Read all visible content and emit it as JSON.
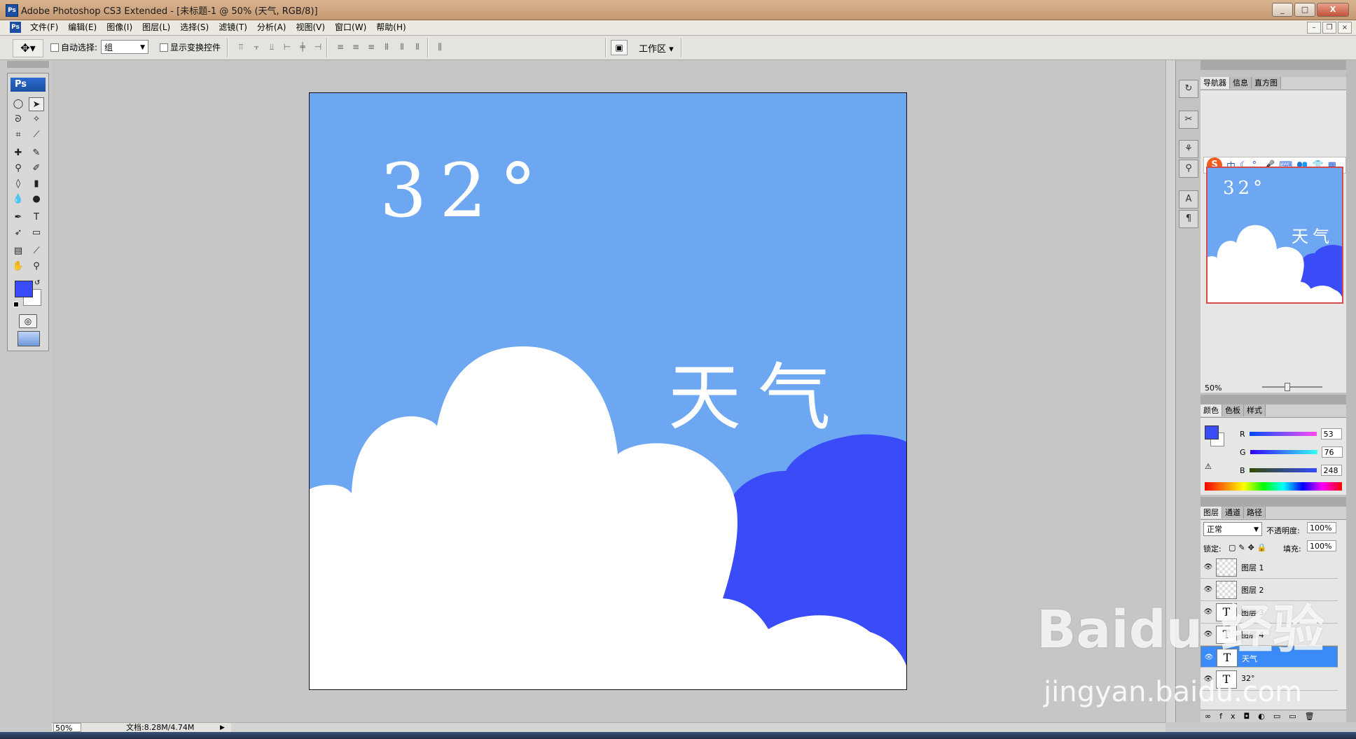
{
  "window": {
    "title": "Adobe Photoshop CS3 Extended - [未标题-1 @ 50% (天气, RGB/8)]",
    "app_badge": "Ps",
    "min": "_",
    "max": "□",
    "close": "X"
  },
  "menu": [
    "文件(F)",
    "编辑(E)",
    "图像(I)",
    "图层(L)",
    "选择(S)",
    "滤镜(T)",
    "分析(A)",
    "视图(V)",
    "窗口(W)",
    "帮助(H)"
  ],
  "options": {
    "auto_select_label": "自动选择:",
    "auto_select_value": "组",
    "show_transform_label": "显示变换控件",
    "workspace_label": "工作区"
  },
  "toolbox": {
    "logo": "Ps"
  },
  "canvas": {
    "temperature_text": "32°",
    "weather_text": "天气",
    "sky_color": "#6da7f2",
    "cloud_color": "#ffffff",
    "back_cloud_color": "#3a4cf8"
  },
  "statusbar": {
    "zoom": "50%",
    "doc_info": "文档:8.28M/4.74M"
  },
  "navigator": {
    "tabs": [
      "导航器",
      "信息",
      "直方图"
    ],
    "zoom": "50%",
    "preview_temp": "32°",
    "preview_weather": "天气"
  },
  "ime": {
    "logo": "S",
    "items": [
      "中",
      "☾",
      "°,",
      "🎤",
      "⌨",
      "👥",
      "👕",
      "▦"
    ]
  },
  "color_panel": {
    "tabs": [
      "颜色",
      "色板",
      "样式"
    ],
    "r_label": "R",
    "r_value": "53",
    "g_label": "G",
    "g_value": "76",
    "b_label": "B",
    "b_value": "248",
    "foreground": "#3a4cf8"
  },
  "layers_panel": {
    "tabs": [
      "图层",
      "通道",
      "路径"
    ],
    "blend_mode": "正常",
    "opacity_label": "不透明度:",
    "opacity_value": "100%",
    "lock_label": "锁定:",
    "fill_label": "填充:",
    "fill_value": "100%",
    "layers": [
      {
        "name": "图层 1",
        "type": "pixel"
      },
      {
        "name": "图层 2",
        "type": "pixel"
      },
      {
        "name": "图层 3",
        "type": "text"
      },
      {
        "name": "图层 4",
        "type": "text"
      },
      {
        "name": "天气",
        "type": "text",
        "selected": true
      },
      {
        "name": "32°",
        "type": "text"
      }
    ]
  },
  "watermark": {
    "brand": "Baidu 经验",
    "url": "jingyan.baidu.com"
  }
}
